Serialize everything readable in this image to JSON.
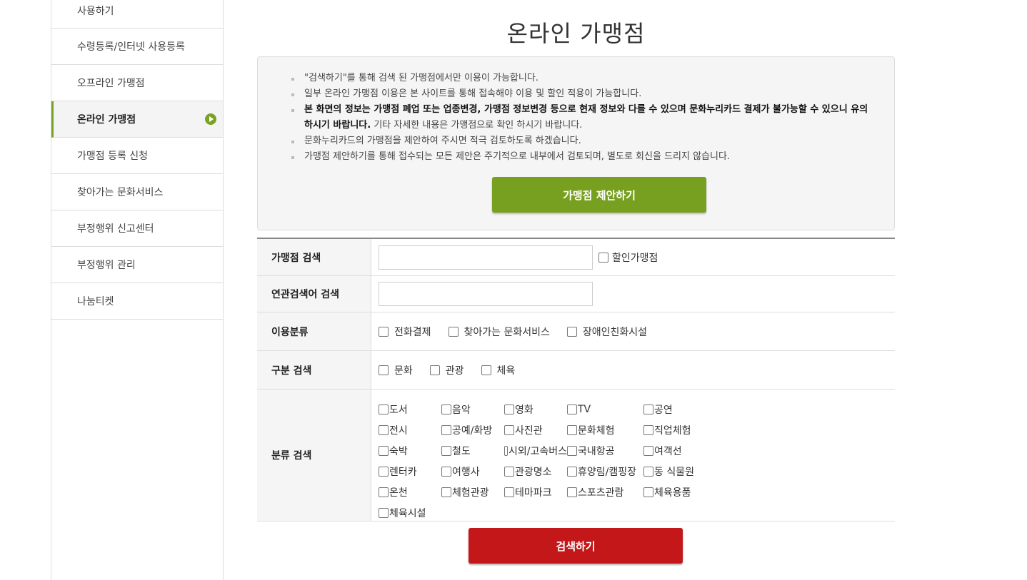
{
  "sidebar": {
    "items": [
      {
        "label": "사용하기"
      },
      {
        "label": "수령등록/인터넷 사용등록"
      },
      {
        "label": "오프라인 가맹점"
      },
      {
        "label": "온라인 가맹점"
      },
      {
        "label": "가맹점 등록 신청"
      },
      {
        "label": "찾아가는 문화서비스"
      },
      {
        "label": "부정행위 신고센터"
      },
      {
        "label": "부정행위 관리"
      },
      {
        "label": "나눔티켓"
      }
    ],
    "active_index": 3
  },
  "page": {
    "title": "온라인 가맹점"
  },
  "notice": {
    "line1": "\"검색하기\"를 통해 검색 된 가맹점에서만 이용이 가능합니다.",
    "line2": "일부 온라인 가맹점 이용은 본 사이트를 통해 접속해야 이용 및 할인 적용이 가능합니다.",
    "line3_bold": "본 화면의 정보는 가맹점 폐업 또는 업종변경, 가맹점 정보변경 등으로 현재 정보와 다를 수 있으며 문화누리카드 결제가 불가능할 수 있으니 유의하시기 바랍니다.",
    "line3_rest": " 기타 자세한 내용은 가맹점으로 확인 하시기 바랍니다.",
    "line4": "문화누리카드의 가맹점을 제안하여 주시면 적극 검토하도록 하겠습니다.",
    "line5": "가맹점 제안하기를 통해 접수되는 모든 제안은 주기적으로 내부에서 검토되며, 별도로 회신을 드리지 않습니다.",
    "suggest_button": "가맹점 제안하기"
  },
  "search": {
    "store_label": "가맹점 검색",
    "store_value": "",
    "discount_label": "할인가맹점",
    "keyword_label": "연관검색어 검색",
    "keyword_value": "",
    "usage_label": "이용분류",
    "usage_options": [
      "전화결제",
      "찾아가는 문화서비스",
      "장애인친화시설"
    ],
    "type_label": "구분 검색",
    "type_options": [
      "문화",
      "관광",
      "체육"
    ],
    "category_label": "분류 검색",
    "categories": [
      "도서",
      "음악",
      "영화",
      "TV",
      "공연",
      "전시",
      "공예/화방",
      "사진관",
      "문화체험",
      "직업체험",
      "숙박",
      "철도",
      "시외/고속버스",
      "국내항공",
      "여객선",
      "렌터카",
      "여행사",
      "관광명소",
      "휴양림/캠핑장",
      "동 식물원",
      "온천",
      "체험관광",
      "테마파크",
      "스포츠관람",
      "체육용품",
      "체육시설"
    ],
    "search_button": "검색하기"
  }
}
